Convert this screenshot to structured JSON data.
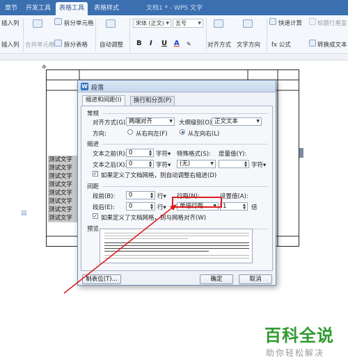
{
  "title_bar": {
    "tabs": [
      "章节",
      "开发工具",
      "表格工具",
      "表格样式"
    ],
    "active_tab_index": 2,
    "doc_title": "文档1 * - WPS 文字"
  },
  "ribbon": {
    "insert_col_1": "插入列",
    "insert_col_2": "插入列",
    "merge_cells": "合并单元格",
    "split_cells": "拆分单元格",
    "split_table": "拆分表格",
    "auto_adjust": "自动调整",
    "font_name": "宋体 (正文)",
    "font_size": "五号",
    "bold": "B",
    "italic": "I",
    "underline": "U",
    "font_color": "A",
    "align": "对齐方式",
    "text_direction": "文字方向",
    "quick_calc": "快速计算",
    "title_repeat": "标题行重复",
    "formula": "fx 公式",
    "to_text": "转换成文本"
  },
  "document": {
    "cell_texts": [
      "测试文字",
      "测试文字",
      "测试文字",
      "测试文字",
      "测试文字",
      "测试文字",
      "测试文字",
      "测试文字"
    ]
  },
  "dialog": {
    "title": "段落",
    "logo": "W",
    "tabs": [
      "缩进和间距(I)",
      "换行和分页(P)"
    ],
    "general": {
      "section": "常规",
      "align_label": "对齐方式(G):",
      "align_value": "两端对齐",
      "outline_label": "大纲级别(O):",
      "outline_value": "正文文本",
      "direction_label": "方向:",
      "rtl_label": "从右向左(F)",
      "ltr_label": "从左向右(L)",
      "direction_selected": "ltr"
    },
    "indent": {
      "section": "缩进",
      "before_label": "文本之前(R):",
      "before_value": "0",
      "before_unit": "字符▾",
      "after_label": "文本之后(X):",
      "after_value": "0",
      "after_unit": "字符▾",
      "special_label": "特殊格式(S):",
      "special_value": "(无)",
      "measure_label": "度量值(Y):",
      "measure_unit": "字符▾",
      "grid_check_label": "如果定义了文档网格，则自动调整右缩进(D)",
      "grid_checked": true
    },
    "spacing": {
      "section": "间距",
      "before_label": "段前(B):",
      "before_value": "0",
      "before_unit": "行▾",
      "after_label": "段后(E):",
      "after_value": "0",
      "after_unit": "行▾",
      "line_label": "行距(N):",
      "line_value": "单倍行距",
      "setting_label": "设置值(A):",
      "setting_value": "1",
      "setting_unit": "倍",
      "grid_check_label": "如果定义了文档网格，则与网格对齐(W)",
      "grid_checked": true
    },
    "preview": {
      "section": "预览"
    },
    "buttons": {
      "tabs": "制表位(T)...",
      "ok": "确定",
      "cancel": "取消"
    }
  },
  "watermark": {
    "main": "百科全说",
    "sub": "助你轻松解决"
  },
  "colors": {
    "titlebar": "#3a6fb0",
    "highlight": "#e01b1b",
    "watermark": "#2e9a2e"
  }
}
